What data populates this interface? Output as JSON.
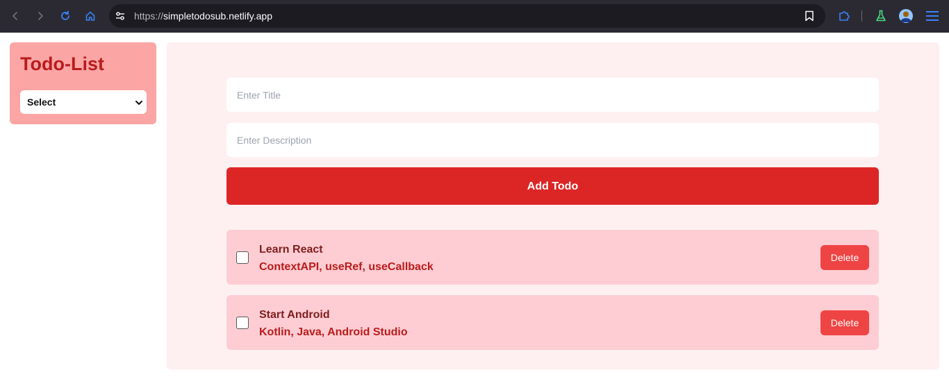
{
  "browser": {
    "url_protocol": "https://",
    "url_host": "simpletodosub.netlify.app"
  },
  "sidebar": {
    "title": "Todo-List",
    "select_value": "Select"
  },
  "form": {
    "title_placeholder": "Enter Title",
    "description_placeholder": "Enter Description",
    "add_button": "Add Todo"
  },
  "todos": [
    {
      "title": "Learn React",
      "description": "ContextAPI, useRef, useCallback",
      "delete_label": "Delete",
      "checked": false
    },
    {
      "title": "Start Android",
      "description": "Kotlin, Java, Android Studio",
      "delete_label": "Delete",
      "checked": false
    }
  ],
  "colors": {
    "accent": "#dc2626",
    "sidebar_bg": "#fca5a5",
    "card_bg": "#fecdd3",
    "delete": "#ef4444"
  }
}
